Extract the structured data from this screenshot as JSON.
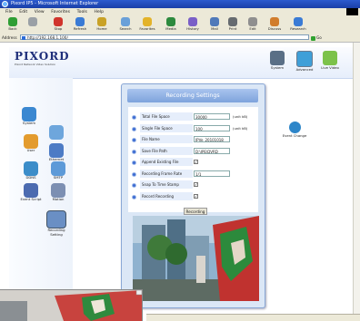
{
  "window": {
    "title": "Pixord IP5 - Microsoft Internet Explorer"
  },
  "menu": [
    "File",
    "Edit",
    "View",
    "Favorites",
    "Tools",
    "Help"
  ],
  "toolbar": [
    {
      "label": "Back",
      "color": "#2f9e35"
    },
    {
      "label": "",
      "color": "#9aa0a6"
    },
    {
      "label": "Stop",
      "color": "#d0342c"
    },
    {
      "label": "Refresh",
      "color": "#3a7bd5"
    },
    {
      "label": "Home",
      "color": "#c9a227"
    },
    {
      "label": "Search",
      "color": "#6aa0d8"
    },
    {
      "label": "Favorites",
      "color": "#e3b32a"
    },
    {
      "label": "Media",
      "color": "#2d8a3e"
    },
    {
      "label": "History",
      "color": "#7a5fc7"
    },
    {
      "label": "Mail",
      "color": "#4f79b9"
    },
    {
      "label": "Print",
      "color": "#666b70"
    },
    {
      "label": "Edit",
      "color": "#8f8f8f"
    },
    {
      "label": "Discuss",
      "color": "#d17d2c"
    },
    {
      "label": "Research",
      "color": "#3a7bd5"
    }
  ],
  "address": {
    "label": "Address",
    "url": "http://192.168.1.100/",
    "go": "Go"
  },
  "brand": {
    "logo": "PIXORD",
    "tagline": "Pixord Network Video Solution"
  },
  "header_nav": [
    {
      "label": "System",
      "color": "#5a6f86"
    },
    {
      "label": "Advanced",
      "color": "#3f9fd8"
    },
    {
      "label": "Live Video",
      "color": "#7cc24a"
    }
  ],
  "sidebar": [
    {
      "label": "System",
      "color": "#3b88d1"
    },
    {
      "label": "",
      "color": "#6ea6dc"
    },
    {
      "label": "User",
      "color": "#e39b2e"
    },
    {
      "label": "Ethernet",
      "color": "#4c7bc5"
    },
    {
      "label": "DDNS",
      "color": "#3c8dc9"
    },
    {
      "label": "SMTP",
      "color": "#5d9ad8"
    },
    {
      "label": "Event Script",
      "color": "#4c6bb0"
    },
    {
      "label": "Motion",
      "color": "#7c8fb2"
    },
    {
      "label": "Recording Setting",
      "color": "#6a8fc4"
    }
  ],
  "event_change": {
    "label": "Event Change",
    "color": "#2e86c9"
  },
  "recording": {
    "title": "Recording Settings",
    "rows": [
      {
        "label": "Total File Space",
        "value": "30000",
        "unit": "(unit kB)",
        "type": "input"
      },
      {
        "label": "Single File Space",
        "value": "100",
        "unit": "(unit kB)",
        "type": "input"
      },
      {
        "label": "File Name",
        "value": "IPVe_20101018",
        "unit": "",
        "type": "input"
      },
      {
        "label": "Save File Path",
        "value": "D:\\IPE\\DVRD",
        "unit": "",
        "type": "input"
      },
      {
        "label": "Append Existing File",
        "value": "✓",
        "unit": "",
        "type": "check"
      },
      {
        "label": "Recording Frame Rate",
        "value": "1/1",
        "unit": "",
        "type": "input"
      },
      {
        "label": "Snap To Time Stamp",
        "value": "✓",
        "unit": "",
        "type": "check"
      },
      {
        "label": "Record Recording",
        "value": "✓",
        "unit": "",
        "type": "check"
      }
    ],
    "button": "Recording"
  }
}
